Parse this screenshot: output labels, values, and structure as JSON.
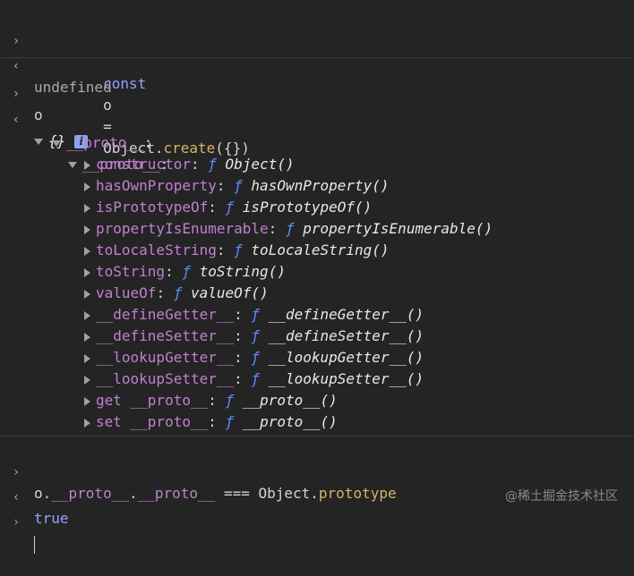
{
  "console": {
    "entry1": {
      "input": {
        "kw": "const",
        "var": "o",
        "eq": "=",
        "obj": "Object",
        "dot": ".",
        "fn": "create",
        "args": "({})"
      },
      "output": "undefined"
    },
    "entry2": {
      "input": "o",
      "output_root": "{}",
      "info_badge": "i",
      "proto1_label": "__proto__",
      "proto2_label": "__proto__",
      "colon": ":",
      "members": [
        {
          "name": "constructor",
          "f": "ƒ",
          "value": "Object()"
        },
        {
          "name": "hasOwnProperty",
          "f": "ƒ",
          "value": "hasOwnProperty()"
        },
        {
          "name": "isPrototypeOf",
          "f": "ƒ",
          "value": "isPrototypeOf()"
        },
        {
          "name": "propertyIsEnumerable",
          "f": "ƒ",
          "value": "propertyIsEnumerable()"
        },
        {
          "name": "toLocaleString",
          "f": "ƒ",
          "value": "toLocaleString()"
        },
        {
          "name": "toString",
          "f": "ƒ",
          "value": "toString()"
        },
        {
          "name": "valueOf",
          "f": "ƒ",
          "value": "valueOf()"
        },
        {
          "name": "__defineGetter__",
          "f": "ƒ",
          "value": "__defineGetter__()"
        },
        {
          "name": "__defineSetter__",
          "f": "ƒ",
          "value": "__defineSetter__()"
        },
        {
          "name": "__lookupGetter__",
          "f": "ƒ",
          "value": "__lookupGetter__()"
        },
        {
          "name": "__lookupSetter__",
          "f": "ƒ",
          "value": "__lookupSetter__()"
        },
        {
          "name": "get __proto__",
          "f": "ƒ",
          "value": "__proto__()"
        },
        {
          "name": "set __proto__",
          "f": "ƒ",
          "value": "__proto__()"
        }
      ]
    },
    "entry3": {
      "input": {
        "a": "o.",
        "b": "__proto__",
        "c": ".",
        "d": "__proto__",
        "e": " === Object.",
        "f": "prototype"
      },
      "output": "true"
    }
  },
  "gutter": {
    "input_icon": "›",
    "output_icon": "‹"
  },
  "watermark": "@稀土掘金技术社区"
}
